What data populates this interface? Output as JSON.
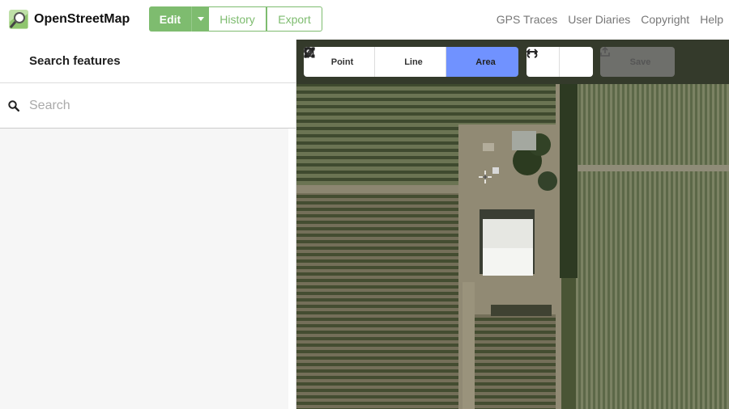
{
  "header": {
    "brand": "OpenStreetMap",
    "edit_label": "Edit",
    "history_label": "History",
    "export_label": "Export",
    "nav": [
      "GPS Traces",
      "User Diaries",
      "Copyright",
      "Help"
    ],
    "accent_color": "#7ebc6f"
  },
  "sidebar": {
    "title": "Search features",
    "search_placeholder": "Search",
    "search_value": ""
  },
  "toolbar": {
    "modes": [
      {
        "label": "Point",
        "icon": "point-marker-icon"
      },
      {
        "label": "Line",
        "icon": "line-icon"
      },
      {
        "label": "Area",
        "icon": "area-icon",
        "active": true
      }
    ],
    "undo_icon": "undo-icon",
    "redo_icon": "redo-icon",
    "save_label": "Save",
    "save_enabled": false,
    "active_color": "#7092ff"
  },
  "map": {
    "imagery": "aerial-farmland"
  }
}
